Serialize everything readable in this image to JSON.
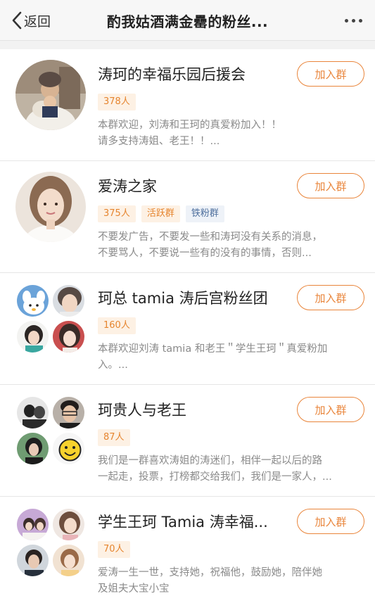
{
  "nav": {
    "back_label": "返回",
    "title": "酌我姑酒满金罍的粉丝..."
  },
  "groups": [
    {
      "name": "涛珂的幸福乐园后援会",
      "join_label": "加入群",
      "count": "378人",
      "desc_line1": "本群欢迎，刘涛和王珂的真爱粉加入！！",
      "desc_line2": "请多支持涛姐、老王！！..."
    },
    {
      "name": "爱涛之家",
      "join_label": "加入群",
      "count": "375人",
      "tag_active": "活跃群",
      "tag_iron": "铁粉群",
      "desc_line1": "不要发广告，不要发一些和涛珂没有关系的消息，",
      "desc_line2": "不要骂人，不要说一些有的没有的事情，否则..."
    },
    {
      "name": "珂总 tamia 涛后宫粉丝团",
      "join_label": "加入群",
      "count": "160人",
      "desc_line1": "本群欢迎刘涛 tamia 和老王＂学生王珂＂真爱粉加",
      "desc_line2": "入。..."
    },
    {
      "name": "珂贵人与老王",
      "join_label": "加入群",
      "count": "87人",
      "desc_line1": "我们是一群喜欢涛姐的涛迷们，相伴一起以后的路",
      "desc_line2": "一起走，投票，打榜都交给我们，我们是一家人，..."
    },
    {
      "name": "学生王珂 Tamia 涛幸福...",
      "join_label": "加入群",
      "count": "70人",
      "desc_line1": "爱涛一生一世，支持她，祝福他，鼓励她，陪伴她",
      "desc_line2": "及姐夫大宝小宝"
    }
  ],
  "colors": {
    "accent": "#e9853b",
    "tag_bg": "#fdf1e4",
    "iron_tag_text": "#4e6f9d",
    "desc_text": "#8a8a8a"
  }
}
